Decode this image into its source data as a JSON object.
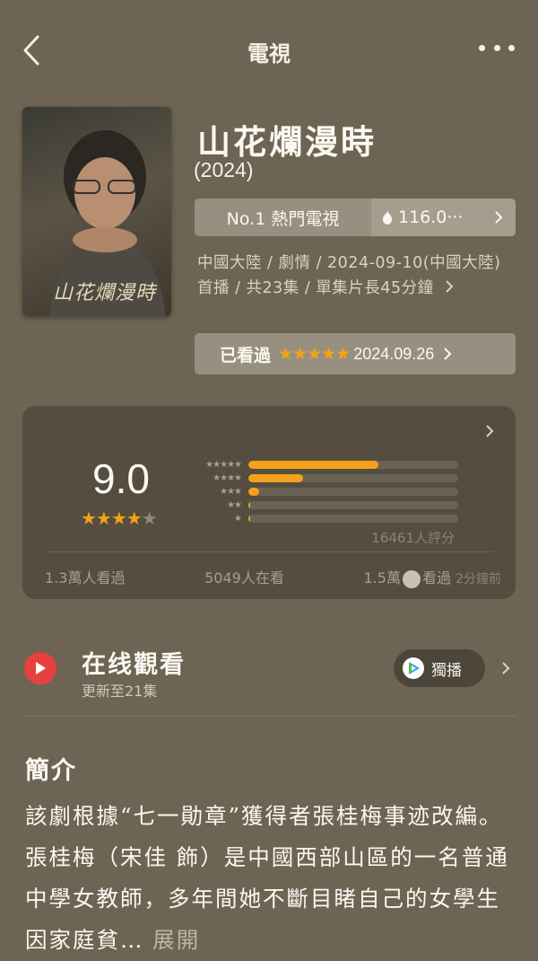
{
  "header": {
    "title": "電視"
  },
  "poster": {
    "overlay_title": "山花爛漫時"
  },
  "show": {
    "title": "山花爛漫時",
    "year": "(2024)",
    "rank_label": "No.1 熱門電視",
    "heat_value": "116.0···",
    "meta": "中國大陸 / 劇情 / 2024-09-10(中國大陸)首播 / 共23集 / 單集片長45分鐘"
  },
  "watched": {
    "label": "已看過",
    "stars": "★★★★★",
    "date": "2024.09.26"
  },
  "rating": {
    "score": "9.0",
    "star_rows": [
      "★★★★★",
      "★★★★",
      "★★★",
      "★★",
      "★"
    ],
    "distribution": [
      0.62,
      0.26,
      0.05,
      0.01,
      0.01
    ],
    "count": "16461人評分",
    "stats": {
      "seen": "1.3萬人看過",
      "watching": "5049人在看",
      "want_prefix": "1.5萬",
      "want_suffix": "看過",
      "time": "2分鐘前"
    }
  },
  "online": {
    "title": "在线觀看",
    "subtitle": "更新至21集",
    "badge": "獨播"
  },
  "intro": {
    "heading": "簡介",
    "body": "該劇根據“七一勛章”獲得者張桂梅事迹改編。 張桂梅（宋佳 飾）是中國西部山區的一名普通中學女教師，多年間她不斷目睹自己的女學生因家庭貧…",
    "expand": "展開"
  },
  "colors": {
    "accent": "#f4a21a",
    "play": "#e8403f",
    "background": "#6e6453"
  }
}
